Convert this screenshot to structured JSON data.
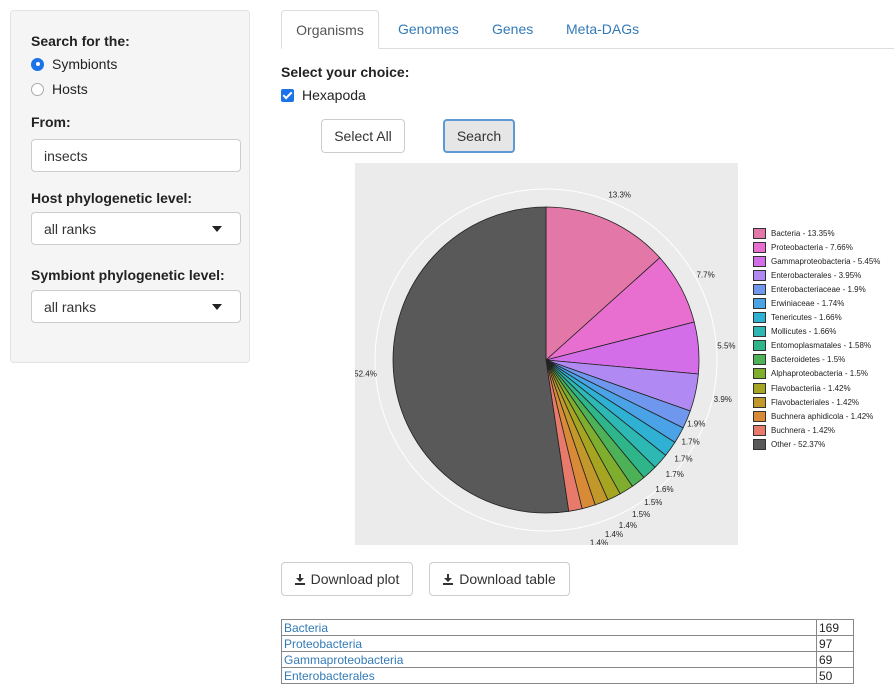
{
  "sidebar": {
    "search_label": "Search for the:",
    "radio_options": [
      "Symbionts",
      "Hosts"
    ],
    "selected_radio": "Symbionts",
    "from_label": "From:",
    "from_value": "insects",
    "host_level_label": "Host phylogenetic level:",
    "host_level_value": "all ranks",
    "symbiont_level_label": "Symbiont phylogenetic level:",
    "symbiont_level_value": "all ranks"
  },
  "tabs": [
    "Organisms",
    "Genomes",
    "Genes",
    "Meta-DAGs"
  ],
  "active_tab": "Organisms",
  "main": {
    "choice_label": "Select your choice:",
    "checkbox_label": "Hexapoda",
    "checkbox_checked": true,
    "select_all": "Select All",
    "search": "Search",
    "download_plot": "Download plot",
    "download_table": "Download table"
  },
  "chart_data": {
    "type": "pie",
    "slices": [
      {
        "label": "Bacteria - 13.35%",
        "value": 13.35,
        "pct_label": "13.3%",
        "color": "#e377a8"
      },
      {
        "label": "Proteobacteria - 7.66%",
        "value": 7.66,
        "pct_label": "7.7%",
        "color": "#e86fd0"
      },
      {
        "label": "Gammaproteobacteria - 5.45%",
        "value": 5.45,
        "pct_label": "5.5%",
        "color": "#d36ee8"
      },
      {
        "label": "Enterobacterales - 3.95%",
        "value": 3.95,
        "pct_label": "3.9%",
        "color": "#b08af2"
      },
      {
        "label": "Enterobacteriaceae - 1.9%",
        "value": 1.9,
        "pct_label": "1.9%",
        "color": "#6f97ee"
      },
      {
        "label": "Erwiniaceae - 1.74%",
        "value": 1.74,
        "pct_label": "1.7%",
        "color": "#4aa3e6"
      },
      {
        "label": "Tenericutes - 1.66%",
        "value": 1.66,
        "pct_label": "1.7%",
        "color": "#2fb1d3"
      },
      {
        "label": "Mollicutes - 1.66%",
        "value": 1.66,
        "pct_label": "1.7%",
        "color": "#2db8b4"
      },
      {
        "label": "Entomoplasmatales - 1.58%",
        "value": 1.58,
        "pct_label": "1.6%",
        "color": "#2eb58a"
      },
      {
        "label": "Bacteroidetes - 1.5%",
        "value": 1.5,
        "pct_label": "1.5%",
        "color": "#4db257"
      },
      {
        "label": "Alphaproteobacteria - 1.5%",
        "value": 1.5,
        "pct_label": "1.5%",
        "color": "#7fae2e"
      },
      {
        "label": "Flavobacteriia - 1.42%",
        "value": 1.42,
        "pct_label": "1.4%",
        "color": "#a5a521"
      },
      {
        "label": "Flavobacteriales - 1.42%",
        "value": 1.42,
        "pct_label": "1.4%",
        "color": "#c2982a"
      },
      {
        "label": "Buchnera aphidicola - 1.42%",
        "value": 1.42,
        "pct_label": "1.4%",
        "color": "#d98a36"
      },
      {
        "label": "Buchnera - 1.42%",
        "value": 1.42,
        "pct_label": "1.4%",
        "color": "#e87a6c"
      },
      {
        "label": "Other - 52.37%",
        "value": 52.37,
        "pct_label": "52.4%",
        "color": "#595959"
      }
    ]
  },
  "table": {
    "rows": [
      {
        "name": "Bacteria",
        "count": "169"
      },
      {
        "name": "Proteobacteria",
        "count": "97"
      },
      {
        "name": "Gammaproteobacteria",
        "count": "69"
      },
      {
        "name": "Enterobacterales",
        "count": "50"
      }
    ]
  }
}
